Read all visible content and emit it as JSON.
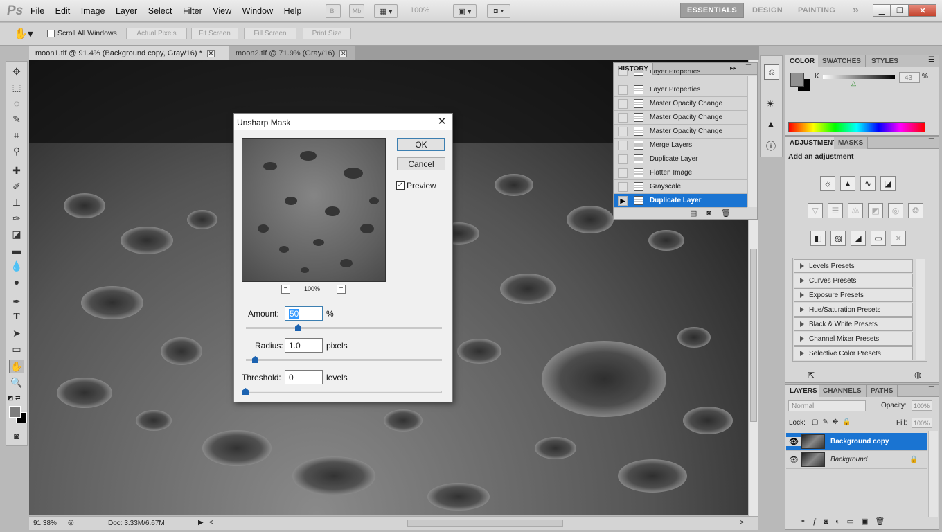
{
  "app": {
    "logo": "Ps",
    "menu": [
      "File",
      "Edit",
      "Image",
      "Layer",
      "Select",
      "Filter",
      "View",
      "Window",
      "Help"
    ],
    "zoom_menu": "100%",
    "workspaces": [
      "ESSENTIALS",
      "DESIGN",
      "PAINTING"
    ],
    "more_ws": "»"
  },
  "toolbar_icons": {
    "br": "Br",
    "mb": "Mb"
  },
  "options": {
    "scroll_all": "Scroll All Windows",
    "actual": "Actual Pixels",
    "fit": "Fit Screen",
    "fill": "Fill Screen",
    "print": "Print Size"
  },
  "tabs": [
    {
      "label": "moon1.tif @ 91.4% (Background copy, Gray/16) *"
    },
    {
      "label": "moon2.tif @ 71.9% (Gray/16)"
    }
  ],
  "status": {
    "zoom": "91.38%",
    "doc": "Doc: 3.33M/6.67M"
  },
  "dialog": {
    "title": "Unsharp Mask",
    "ok": "OK",
    "cancel": "Cancel",
    "preview": "Preview",
    "zoom": "100%",
    "amount_label": "Amount:",
    "amount": "50",
    "amount_unit": "%",
    "radius_label": "Radius:",
    "radius": "1.0",
    "radius_unit": "pixels",
    "threshold_label": "Threshold:",
    "threshold": "0",
    "threshold_unit": "levels"
  },
  "history": {
    "tab": "HISTORY",
    "items": [
      "Layer Properties",
      "Layer Properties",
      "Master Opacity Change",
      "Master Opacity Change",
      "Master Opacity Change",
      "Merge Layers",
      "Duplicate Layer",
      "Flatten Image",
      "Grayscale",
      "Duplicate Layer"
    ]
  },
  "color": {
    "tabs": [
      "COLOR",
      "SWATCHES",
      "STYLES"
    ],
    "channel": "K",
    "value": "43",
    "unit": "%"
  },
  "adjustments": {
    "tabs": [
      "ADJUSTMENTS",
      "MASKS"
    ],
    "heading": "Add an adjustment",
    "presets": [
      "Levels Presets",
      "Curves Presets",
      "Exposure Presets",
      "Hue/Saturation Presets",
      "Black & White Presets",
      "Channel Mixer Presets",
      "Selective Color Presets"
    ]
  },
  "layers": {
    "tabs": [
      "LAYERS",
      "CHANNELS",
      "PATHS"
    ],
    "mode": "Normal",
    "opacity_label": "Opacity:",
    "opacity": "100%",
    "lock_label": "Lock:",
    "fill_label": "Fill:",
    "fill": "100%",
    "items": [
      {
        "name": "Background copy"
      },
      {
        "name": "Background"
      }
    ]
  }
}
